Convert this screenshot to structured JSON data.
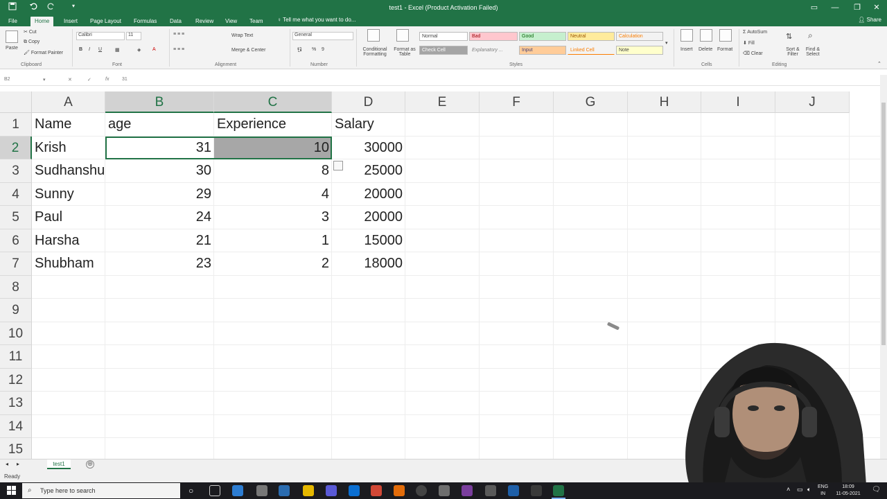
{
  "window": {
    "title": "test1 - Excel (Product Activation Failed)",
    "qa_save_icon": "save-icon",
    "qa_undo_icon": "undo-icon",
    "qa_redo_icon": "redo-icon",
    "qa_custom": "▾",
    "minimize": "—",
    "restore": "❐",
    "close": "✕"
  },
  "tabs": [
    "File",
    "Home",
    "Insert",
    "Page Layout",
    "Formulas",
    "Data",
    "Review",
    "View",
    "Team"
  ],
  "active_tab": "Home",
  "tell_me": "Tell me what you want to do...",
  "share": "Share",
  "ribbon": {
    "clipboard": {
      "paste": "Paste",
      "cut": "Cut",
      "copy": "Copy",
      "format_painter": "Format Painter",
      "label": "Clipboard"
    },
    "font": {
      "name": "Calibri",
      "size": "11",
      "bold": "B",
      "italic": "I",
      "underline": "U",
      "label": "Font"
    },
    "alignment": {
      "wrap_text": "Wrap Text",
      "merge_center": "Merge & Center",
      "label": "Alignment"
    },
    "number": {
      "format": "General",
      "percent": "%",
      "comma": "9",
      "label": "Number"
    },
    "styles": {
      "conditional": "Conditional Formatting",
      "format_as_table": "Format as Table",
      "cells": [
        "Normal",
        "Bad",
        "Good",
        "Neutral",
        "Calculation",
        "Check Cell",
        "Explanatory ...",
        "Input",
        "Linked Cell",
        "Note"
      ],
      "label": "Styles"
    },
    "cells": {
      "insert": "Insert",
      "delete": "Delete",
      "format": "Format",
      "label": "Cells"
    },
    "editing": {
      "autosum": "AutoSum",
      "fill": "Fill",
      "clear": "Clear",
      "sort_filter": "Sort & Filter",
      "find_select": "Find & Select",
      "label": "Editing"
    }
  },
  "formula_bar": {
    "name_box": "B2",
    "value": "31"
  },
  "columns": [
    "A",
    "B",
    "C",
    "D",
    "E",
    "F",
    "G",
    "H",
    "I",
    "J"
  ],
  "rows": [
    "1",
    "2",
    "3",
    "4",
    "5",
    "6",
    "7",
    "8",
    "9",
    "10",
    "11",
    "12",
    "13",
    "14",
    "15"
  ],
  "headers": [
    "Name",
    "age",
    "Experience",
    "Salary"
  ],
  "data_rows": [
    [
      "Krish",
      "31",
      "10",
      "30000"
    ],
    [
      "Sudhanshu",
      "30",
      "8",
      "25000"
    ],
    [
      "Sunny",
      "29",
      "4",
      "20000"
    ],
    [
      "Paul",
      "24",
      "3",
      "20000"
    ],
    [
      "Harsha",
      "21",
      "1",
      "15000"
    ],
    [
      "Shubham",
      "23",
      "2",
      "18000"
    ]
  ],
  "sheet_tab": "test1",
  "add_sheet": "⊕",
  "status": "Ready",
  "taskbar": {
    "search_placeholder": "Type here to search",
    "lang": "ENG",
    "region": "IN",
    "time": "18:09",
    "date": "11-05-2021"
  },
  "colors": {
    "accent": "#217346",
    "taskbar": "#1b1b1f"
  }
}
